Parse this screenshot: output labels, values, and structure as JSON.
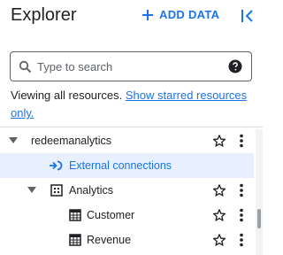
{
  "header": {
    "title": "Explorer",
    "add_data_label": "ADD DATA"
  },
  "search": {
    "placeholder": "Type to search"
  },
  "notice": {
    "text": "Viewing all resources.",
    "link": "Show starred resources only."
  },
  "tree": [
    {
      "label": "redeemanalytics",
      "kind": "project",
      "expanded": true,
      "icon": "none"
    },
    {
      "label": "External connections",
      "kind": "connections",
      "highlighted": true,
      "icon": "external-connection-icon"
    },
    {
      "label": "Analytics",
      "kind": "dataset",
      "expanded": true,
      "icon": "dataset-icon"
    },
    {
      "label": "Customer",
      "kind": "table",
      "icon": "table-icon"
    },
    {
      "label": "Revenue",
      "kind": "table",
      "icon": "table-icon"
    }
  ],
  "colors": {
    "accent": "#1a73e8",
    "highlight": "#e8f0fe",
    "text": "#202124",
    "icon": "#5f6368"
  }
}
